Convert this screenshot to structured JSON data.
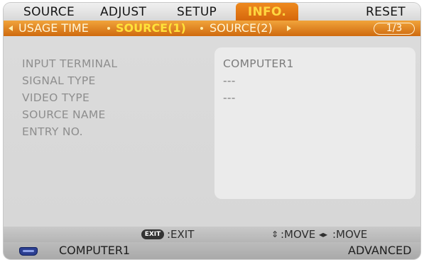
{
  "menu": {
    "tabs": [
      "SOURCE",
      "ADJUST",
      "SETUP",
      "INFO.",
      "RESET"
    ],
    "active_tab": "INFO."
  },
  "submenu": {
    "items": [
      "USAGE TIME",
      "SOURCE(1)",
      "SOURCE(2)"
    ],
    "active": "SOURCE(1)",
    "page": "1/3"
  },
  "info": {
    "labels": [
      "INPUT TERMINAL",
      "SIGNAL TYPE",
      "VIDEO TYPE",
      "SOURCE NAME",
      "ENTRY NO."
    ],
    "values": [
      "COMPUTER1",
      "---",
      "---",
      "",
      ""
    ]
  },
  "help": {
    "exit_badge": "EXIT",
    "exit_label": ":EXIT",
    "move_vertical": ":MOVE",
    "move_horizontal": ":MOVE"
  },
  "status": {
    "source": "COMPUTER1",
    "mode": "ADVANCED"
  },
  "colors": {
    "active_tab": "#e07a12",
    "active_text": "#ffe23a",
    "background": "#d8d8d8"
  }
}
